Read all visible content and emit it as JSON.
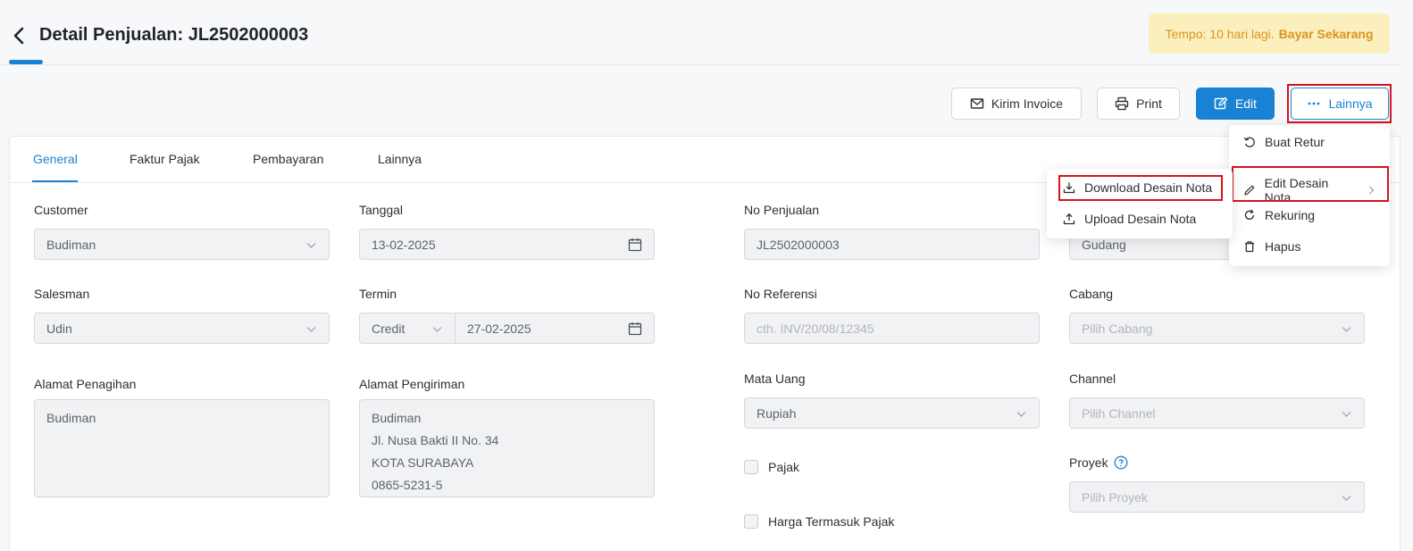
{
  "header": {
    "title": "Detail Penjualan: JL2502000003",
    "tempo_text": "Tempo: 10 hari lagi.",
    "tempo_link": "Bayar Sekarang"
  },
  "actions": {
    "kirim_invoice": "Kirim Invoice",
    "print": "Print",
    "edit": "Edit",
    "lainnya": "Lainnya"
  },
  "tabs": [
    "General",
    "Faktur Pajak",
    "Pembayaran",
    "Lainnya"
  ],
  "form": {
    "customer": {
      "label": "Customer",
      "value": "Budiman"
    },
    "tanggal": {
      "label": "Tanggal",
      "value": "13-02-2025"
    },
    "no_penjualan": {
      "label": "No Penjualan",
      "value": "JL2502000003"
    },
    "gudang": {
      "value": "Gudang"
    },
    "salesman": {
      "label": "Salesman",
      "value": "Udin"
    },
    "termin": {
      "label": "Termin",
      "type": "Credit",
      "date": "27-02-2025"
    },
    "no_referensi": {
      "label": "No Referensi",
      "placeholder": "cth. INV/20/08/12345"
    },
    "cabang": {
      "label": "Cabang",
      "placeholder": "Pilih Cabang"
    },
    "alamat_penagihan": {
      "label": "Alamat Penagihan",
      "value": "Budiman"
    },
    "alamat_pengiriman": {
      "label": "Alamat Pengiriman",
      "lines": [
        "Budiman",
        "Jl. Nusa Bakti II No. 34",
        "KOTA SURABAYA",
        "0865-5231-5"
      ]
    },
    "mata_uang": {
      "label": "Mata Uang",
      "value": "Rupiah"
    },
    "channel": {
      "label": "Channel",
      "placeholder": "Pilih Channel"
    },
    "pajak": {
      "label": "Pajak",
      "checked": false
    },
    "harga_termasuk_pajak": {
      "label": "Harga Termasuk Pajak",
      "checked": false
    },
    "proyek": {
      "label": "Proyek",
      "placeholder": "Pilih Proyek"
    }
  },
  "lainnya_menu": {
    "items": [
      "Buat Retur",
      "Edit Desain Nota",
      "Rekuring",
      "Hapus"
    ]
  },
  "submenu": {
    "items": [
      "Download Desain Nota",
      "Upload Desain Nota"
    ]
  },
  "colors": {
    "primary": "#1a82d4",
    "highlight": "#d7131b",
    "banner_bg": "#fcefbe",
    "banner_text": "#d99521"
  }
}
